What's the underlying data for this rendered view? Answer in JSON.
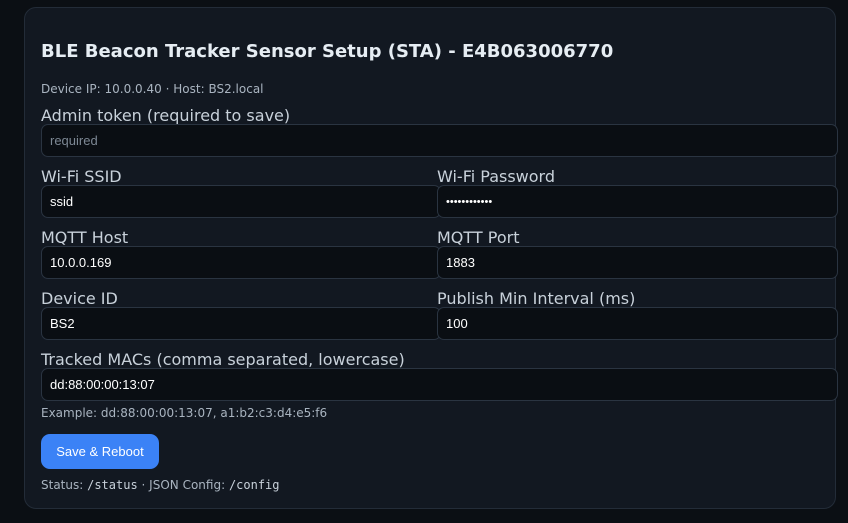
{
  "page": {
    "title": "BLE Beacon Tracker Sensor Setup (STA) - E4B063006770",
    "device_ip_label": "Device IP:",
    "device_ip": "10.0.0.40",
    "separator": "·",
    "host_label": "Host:",
    "host": "BS2.local"
  },
  "form": {
    "admin_token": {
      "label": "Admin token (required to save)",
      "value": "",
      "placeholder": "required"
    },
    "wifi_ssid": {
      "label": "Wi-Fi SSID",
      "value": "ssid"
    },
    "wifi_password": {
      "label": "Wi-Fi Password",
      "value": "••••••••••••"
    },
    "mqtt_host": {
      "label": "MQTT Host",
      "value": "10.0.0.169"
    },
    "mqtt_port": {
      "label": "MQTT Port",
      "value": "1883"
    },
    "device_id": {
      "label": "Device ID",
      "value": "BS2"
    },
    "publish_min_interval": {
      "label": "Publish Min Interval (ms)",
      "value": "100"
    },
    "tracked_macs": {
      "label": "Tracked MACs (comma separated, lowercase)",
      "value": "dd:88:00:00:13:07"
    },
    "example": "Example: dd:88:00:00:13:07, a1:b2:c3:d4:e5:f6",
    "save_label": "Save & Reboot"
  },
  "footer": {
    "status_label": "Status:",
    "status_path": "/status",
    "separator": "·",
    "json_label": "JSON Config:",
    "config_path": "/config"
  }
}
